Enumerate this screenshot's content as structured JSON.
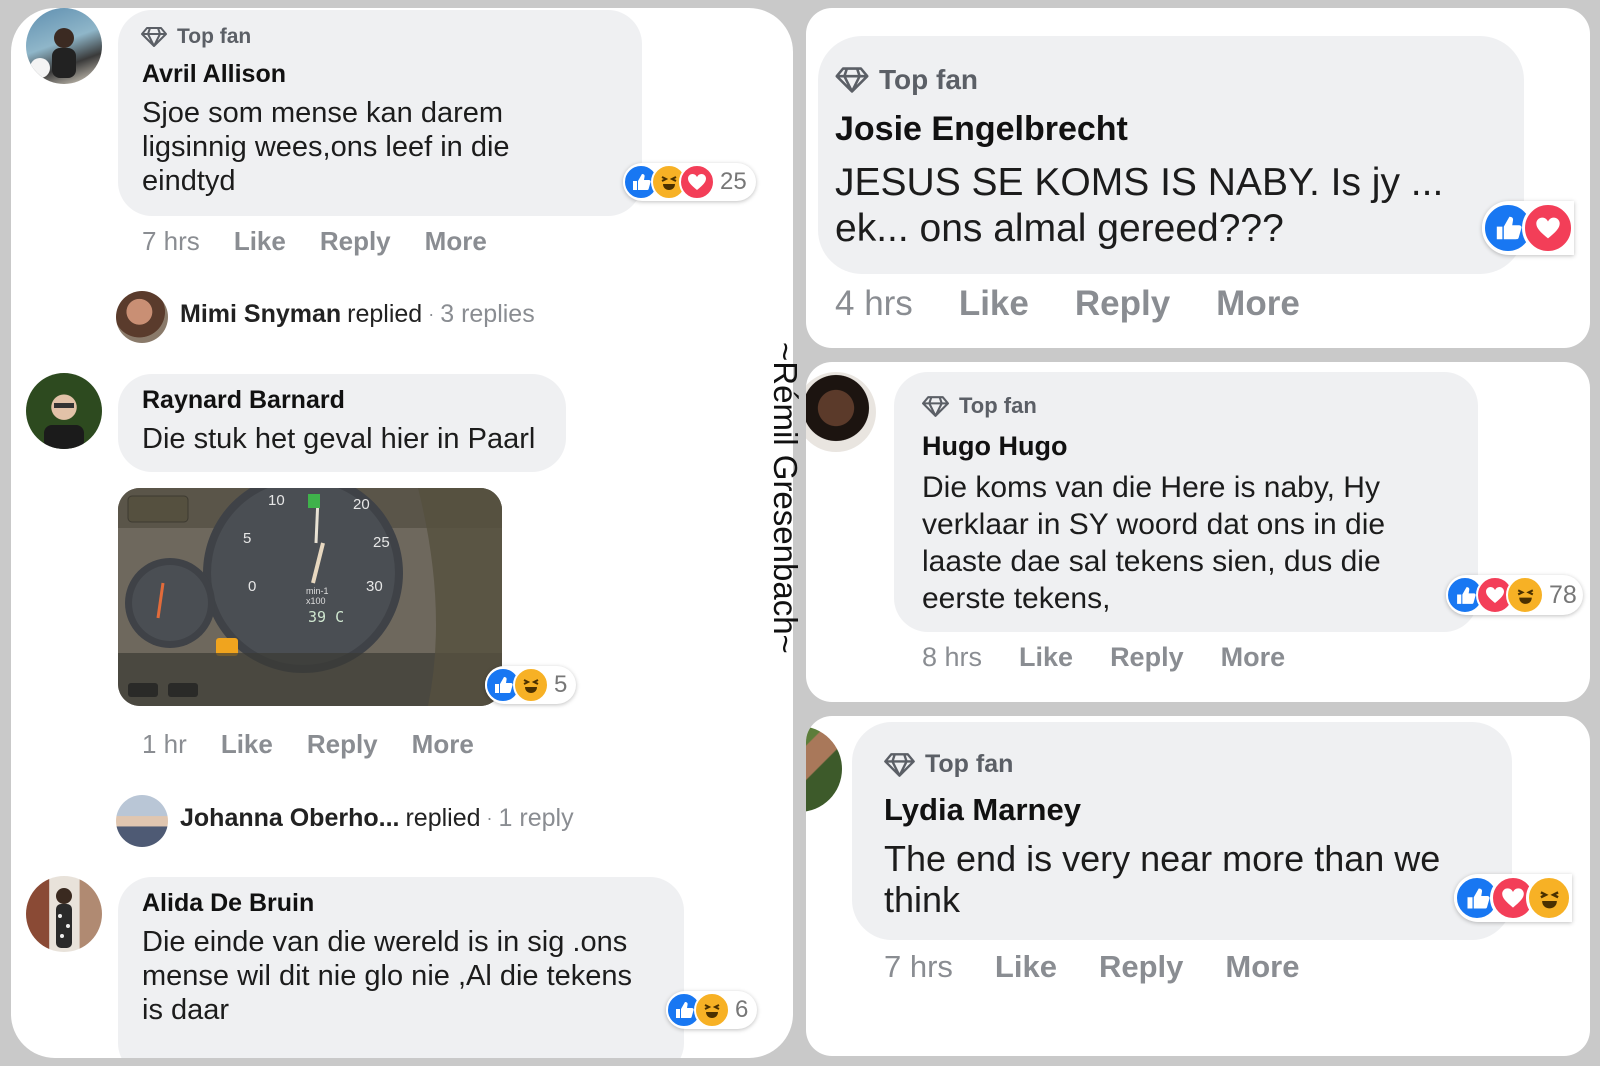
{
  "left_panel": {
    "comment1": {
      "badge": "Top fan",
      "name": "Avril Allison",
      "lines": [
        "Sjoe som mense kan darem",
        "ligsinnig wees,ons leef in die",
        "eindtyd"
      ],
      "reaction_count": "25",
      "time": "7 hrs",
      "like": "Like",
      "reply": "Reply",
      "more": "More"
    },
    "replies1": {
      "name": "Mimi Snyman",
      "verb": "replied",
      "sep": "·",
      "count": "3 replies"
    },
    "comment2": {
      "name": "Raynard Barnard",
      "text": "Die stuk het geval hier in Paarl",
      "gauge": {
        "ticks": [
          "10",
          "20",
          "5",
          "25",
          "0",
          "30"
        ],
        "unit_label": "min-1",
        "scale_label": "x100",
        "readout": "39 C"
      },
      "reaction_count": "5",
      "time": "1 hr",
      "like": "Like",
      "reply": "Reply",
      "more": "More"
    },
    "replies2": {
      "name": "Johanna Oberho...",
      "verb": "replied",
      "sep": "·",
      "count": "1 reply"
    },
    "comment3": {
      "name": "Alida De Bruin",
      "lines": [
        "Die einde van die wereld is in sig .ons",
        "mense wil dit nie glo nie ,Al die tekens",
        "is daar"
      ],
      "reaction_count": "6"
    }
  },
  "watermark": "~Rémil Gresenbach~",
  "right_panel_1": {
    "badge": "Top fan",
    "name": "Josie Engelbrecht",
    "lines": [
      "JESUS SE KOMS IS NABY. Is jy ...",
      "ek... ons almal gereed???"
    ],
    "time": "4 hrs",
    "like": "Like",
    "reply": "Reply",
    "more": "More"
  },
  "right_panel_2": {
    "badge": "Top fan",
    "name": "Hugo Hugo",
    "lines": [
      "Die koms van die Here is naby, Hy",
      "verklaar in SY woord dat ons in die",
      "laaste dae sal tekens sien, dus die",
      "eerste tekens,"
    ],
    "reaction_count": "78",
    "time": "8 hrs",
    "like": "Like",
    "reply": "Reply",
    "more": "More"
  },
  "right_panel_3": {
    "badge": "Top fan",
    "name": "Lydia Marney",
    "lines": [
      "The end is very near more than we",
      "think"
    ],
    "time": "7 hrs",
    "like": "Like",
    "reply": "Reply",
    "more": "More"
  },
  "icons": {
    "badge": "diamond-icon",
    "like": "thumbs-up-icon",
    "haha": "laughing-face-icon",
    "love": "heart-icon"
  },
  "colors": {
    "like_blue": "#1877f2",
    "haha_yellow": "#f7b125",
    "love_red": "#f33e58",
    "bubble_gray": "#eff0f2",
    "meta_gray": "#8a8d92"
  }
}
